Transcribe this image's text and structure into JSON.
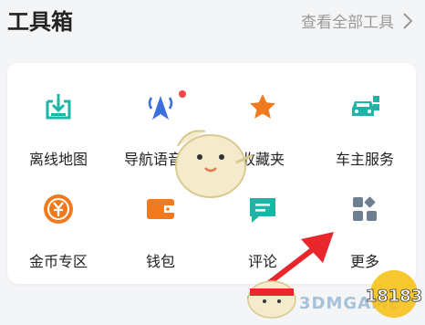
{
  "header": {
    "title": "工具箱",
    "view_all": "查看全部工具"
  },
  "tools": [
    {
      "label": "离线地图",
      "icon": "offline-map-icon",
      "color": "#1fb5a6"
    },
    {
      "label": "导航语音包",
      "icon": "navigation-voice-icon",
      "color": "#3b6fe0",
      "badge": true
    },
    {
      "label": "收藏夹",
      "icon": "star-icon",
      "color": "#f07a1d"
    },
    {
      "label": "车主服务",
      "icon": "car-service-icon",
      "color": "#1fb5a6"
    },
    {
      "label": "金币专区",
      "icon": "gold-coin-icon",
      "color": "#f07a1d"
    },
    {
      "label": "钱包",
      "icon": "wallet-icon",
      "color": "#f07a1d"
    },
    {
      "label": "评论",
      "icon": "comment-icon",
      "color": "#1fb5a6"
    },
    {
      "label": "更多",
      "icon": "more-grid-icon",
      "color": "#6f7f92"
    }
  ],
  "watermark": {
    "site": "3DMGAME",
    "logo": "18183"
  },
  "colors": {
    "accent_teal": "#1fb5a6",
    "accent_orange": "#f07a1d",
    "accent_blue": "#3b6fe0",
    "badge_red": "#f04848",
    "arrow_red": "#e8262c"
  }
}
